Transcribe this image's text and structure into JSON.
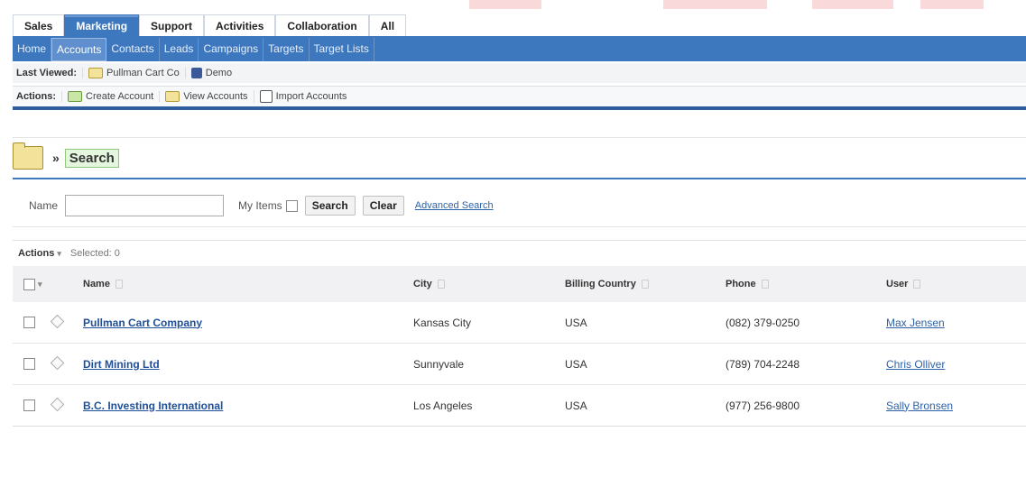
{
  "module_tabs": [
    "Sales",
    "Marketing",
    "Support",
    "Activities",
    "Collaboration",
    "All"
  ],
  "module_active": "Marketing",
  "sub_tabs": [
    "Home",
    "Accounts",
    "Contacts",
    "Leads",
    "Campaigns",
    "Targets",
    "Target Lists"
  ],
  "sub_active": "Accounts",
  "last_viewed": {
    "label": "Last Viewed:",
    "items": [
      "Pullman Cart Co",
      "Demo"
    ]
  },
  "actions_strip": {
    "label": "Actions:",
    "items": [
      "Create Account",
      "View Accounts",
      "Import Accounts"
    ]
  },
  "page": {
    "breadcrumb_sep": "»",
    "title": "Search"
  },
  "search": {
    "name_label": "Name",
    "name_value": "",
    "my_items_label": "My Items",
    "search_button": "Search",
    "clear_button": "Clear",
    "advanced_link": "Advanced Search"
  },
  "list": {
    "actions_label": "Actions",
    "selected_text": "Selected: 0",
    "columns": [
      "Name",
      "City",
      "Billing Country",
      "Phone",
      "User"
    ],
    "rows": [
      {
        "name": "Pullman Cart Company",
        "city": "Kansas City",
        "country": "USA",
        "phone": "(082) 379-0250",
        "user": "Max Jensen"
      },
      {
        "name": "Dirt Mining Ltd",
        "city": "Sunnyvale",
        "country": "USA",
        "phone": "(789) 704-2248",
        "user": "Chris Olliver"
      },
      {
        "name": "B.C. Investing International",
        "city": "Los Angeles",
        "country": "USA",
        "phone": "(977) 256-9800",
        "user": "Sally Bronsen"
      }
    ]
  },
  "colors": {
    "primary_blue": "#3d78bf",
    "dark_blue_rule": "#2f5e9e",
    "link": "#1f4f9a",
    "search_title_bg": "#e5f6df"
  }
}
